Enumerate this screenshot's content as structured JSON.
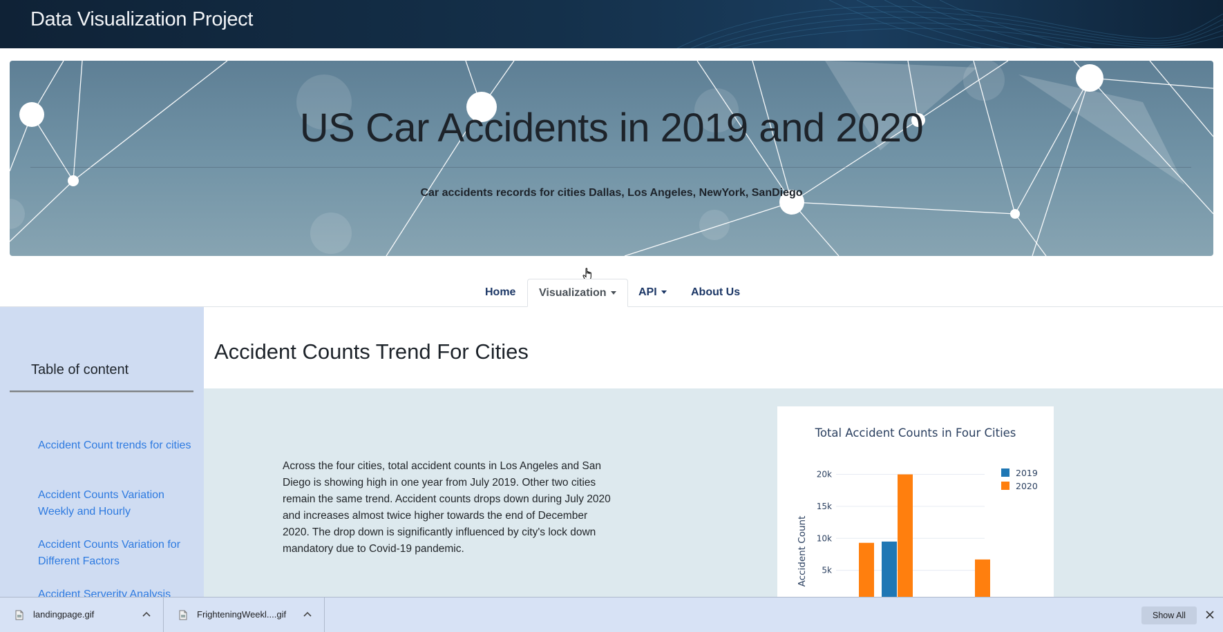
{
  "header": {
    "brand": "Data Visualization Project"
  },
  "hero": {
    "title": "US Car Accidents in 2019 and 2020",
    "subtitle": "Car accidents records for cities Dallas, Los Angeles, NewYork, SanDiego"
  },
  "nav": {
    "items": [
      {
        "label": "Home"
      },
      {
        "label": "Visualization",
        "dropdown": true,
        "active": true
      },
      {
        "label": "API",
        "dropdown": true
      },
      {
        "label": "About Us"
      }
    ]
  },
  "sidebar": {
    "title": "Table of content",
    "links": [
      {
        "label": "Accident Count trends for cities"
      },
      {
        "label": "Accident Counts Variation Weekly and Hourly"
      },
      {
        "label": "Accident Counts Variation for Different Factors"
      },
      {
        "label": "Accident Serverity Analysis"
      }
    ]
  },
  "main": {
    "section_title": "Accident Counts Trend For Cities",
    "description": "Across the four cities, total accident counts in Los Angeles and San Diego is showing high in one year from July 2019. Other two cities remain the same trend. Accident counts drops down during July 2020 and increases almost twice higher towards the end of December 2020. The drop down is significantly influenced by city's lock down mandatory due to Covid-19 pandemic."
  },
  "chart_data": {
    "type": "bar",
    "title": "Total Accident Counts in Four Cities",
    "ylabel": "Accident Count",
    "yticks": [
      "5k",
      "10k",
      "15k",
      "20k"
    ],
    "ylim": [
      0,
      22000
    ],
    "legend_position": "top-right",
    "series": [
      {
        "name": "2019",
        "color": "#1f77b4",
        "values": [
          null,
          9500,
          null
        ]
      },
      {
        "name": "2020",
        "color": "#ff7f0e",
        "values": [
          9300,
          20000,
          6700
        ]
      }
    ],
    "group_slots": [
      0,
      1,
      3
    ]
  },
  "downloads": {
    "items": [
      {
        "name": "landingpage.gif"
      },
      {
        "name": "FrighteningWeekl....gif"
      }
    ],
    "show_all": "Show All"
  },
  "colors": {
    "nav_link": "#1c3766",
    "toc_link": "#2d7ae0",
    "sidebar_bg": "#cfdcf2",
    "content_bg": "#dde9ee"
  }
}
